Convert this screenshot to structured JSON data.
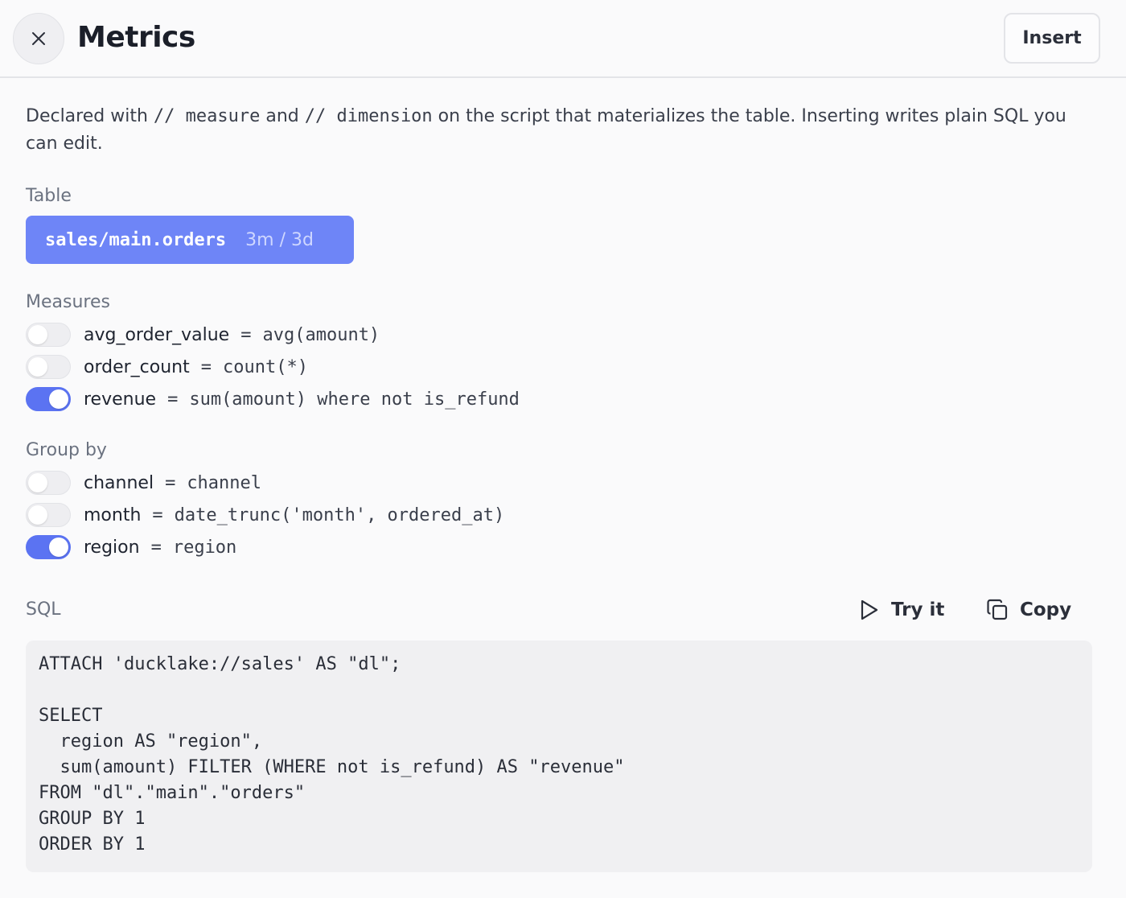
{
  "header": {
    "title": "Metrics",
    "insert_label": "Insert"
  },
  "description": {
    "part1": "Declared with ",
    "code1": "// measure",
    "part2": " and ",
    "code2": "// dimension",
    "part3": " on the script that materializes the table. Inserting writes plain SQL you can edit."
  },
  "table": {
    "section_label": "Table",
    "name": "sales/main.orders",
    "meta": "3m / 3d"
  },
  "measures": {
    "section_label": "Measures",
    "items": [
      {
        "label": "avg_order_value",
        "eq": "=",
        "expr": "avg(amount)",
        "enabled": false
      },
      {
        "label": "order_count",
        "eq": "=",
        "expr": "count(*)",
        "enabled": false
      },
      {
        "label": "revenue",
        "eq": "=",
        "expr": "sum(amount) where not is_refund",
        "enabled": true
      }
    ]
  },
  "group_by": {
    "section_label": "Group by",
    "items": [
      {
        "label": "channel",
        "eq": "=",
        "expr": "channel",
        "enabled": false
      },
      {
        "label": "month",
        "eq": "=",
        "expr": "date_trunc('month', ordered_at)",
        "enabled": false
      },
      {
        "label": "region",
        "eq": "=",
        "expr": "region",
        "enabled": true
      }
    ]
  },
  "sql": {
    "section_label": "SQL",
    "try_label": "Try it",
    "copy_label": "Copy",
    "code": "ATTACH 'ducklake://sales' AS \"dl\";\n\nSELECT\n  region AS \"region\",\n  sum(amount) FILTER (WHERE not is_refund) AS \"revenue\"\nFROM \"dl\".\"main\".\"orders\"\nGROUP BY 1\nORDER BY 1"
  },
  "colors": {
    "accent": "#5b73f2",
    "chip": "#6e85f7"
  },
  "icons": {
    "close": "close-icon",
    "play": "play-icon",
    "copy": "copy-icon"
  }
}
